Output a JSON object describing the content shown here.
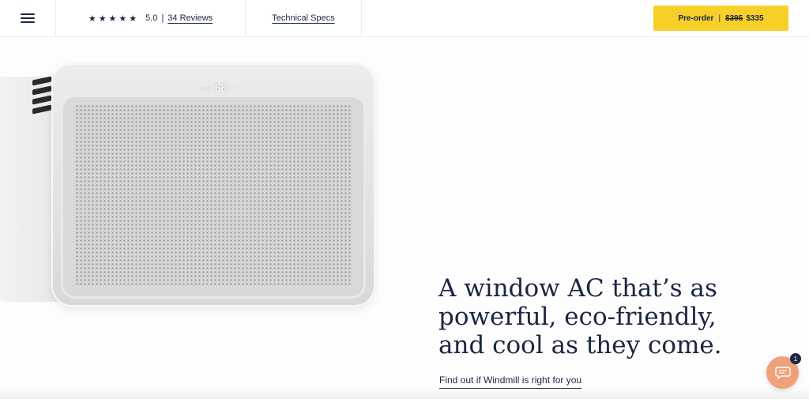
{
  "header": {
    "menu_icon": "hamburger-icon",
    "stars": "★★★★★",
    "rating": "5.0",
    "separator": "|",
    "reviews_label": "34 Reviews",
    "specs_label": "Technical Specs",
    "preorder": {
      "label": "Pre-order",
      "separator": "|",
      "old_price": "$395",
      "new_price": "$335",
      "color": "#f6d029"
    }
  },
  "product": {
    "display_mode": "cool",
    "display_temp": "68",
    "display_unit": "°"
  },
  "hero": {
    "headline": "A window AC that’s as powerful, eco-friendly, and cool as they come.",
    "link_label": "Find out if Windmill is right for you"
  },
  "chat": {
    "icon": "chat-bubble-icon",
    "badge_count": "1",
    "color": "#f0a07a"
  }
}
